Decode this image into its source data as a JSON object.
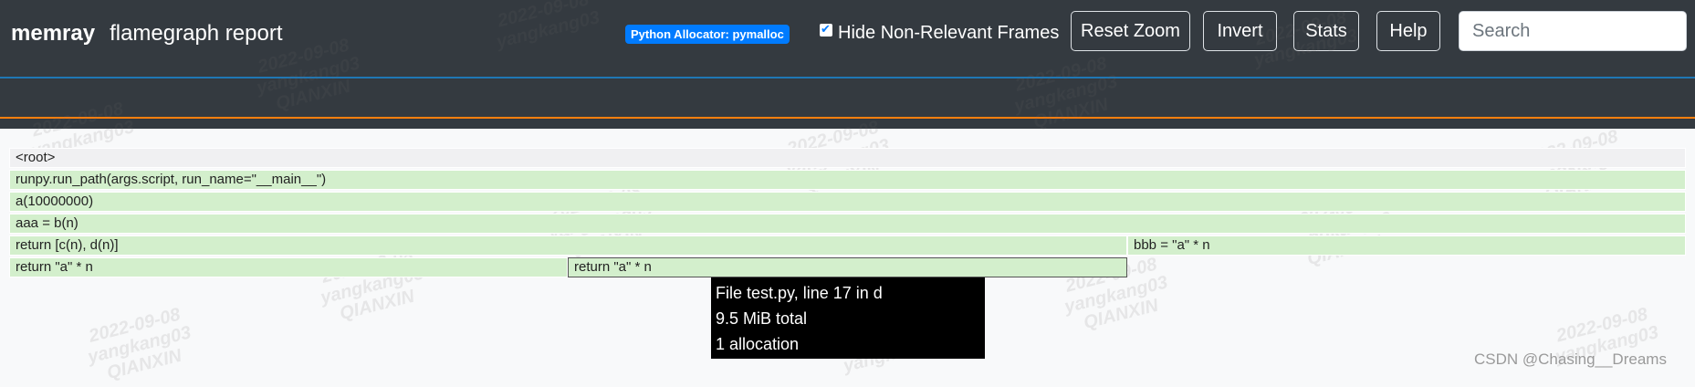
{
  "header": {
    "app_name": "memray",
    "report_title": "flamegraph report",
    "allocator_badge": "Python Allocator: pymalloc",
    "hide_frames_label": "Hide Non-Relevant Frames",
    "hide_frames_checked": true,
    "buttons": {
      "reset_zoom": "Reset Zoom",
      "invert": "Invert",
      "stats": "Stats",
      "help": "Help"
    },
    "search_placeholder": "Search"
  },
  "flamegraph": {
    "frames": [
      {
        "label": "<root>",
        "depth": 0
      },
      {
        "label": "runpy.run_path(args.script, run_name=\"__main__\")",
        "depth": 1
      },
      {
        "label": "a(10000000)",
        "depth": 2
      },
      {
        "label": "aaa = b(n)",
        "depth": 3
      },
      {
        "label": "return [c(n), d(n)]",
        "depth": 4
      },
      {
        "label": "bbb = \"a\" * n",
        "depth": 4
      },
      {
        "label": "return \"a\" * n",
        "depth": 5
      },
      {
        "label": "return \"a\" * n",
        "depth": 5
      }
    ],
    "frame_color": "#d3efcc",
    "root_color": "#f0f0f2"
  },
  "tooltip": {
    "line1": "File test.py, line 17 in d",
    "line2": "9.5 MiB total",
    "line3": "1 allocation"
  },
  "watermark": {
    "date": "2022-09-08",
    "user": "yangkang03",
    "org": "QIANXIN"
  },
  "credit": "CSDN @Chasing__Dreams",
  "colors": {
    "navbar_bg": "#343a40",
    "badge_bg": "#007bff",
    "timeline_blue": "#1f77b4",
    "timeline_orange": "#ff7f0e",
    "tooltip_bg": "#000000"
  }
}
